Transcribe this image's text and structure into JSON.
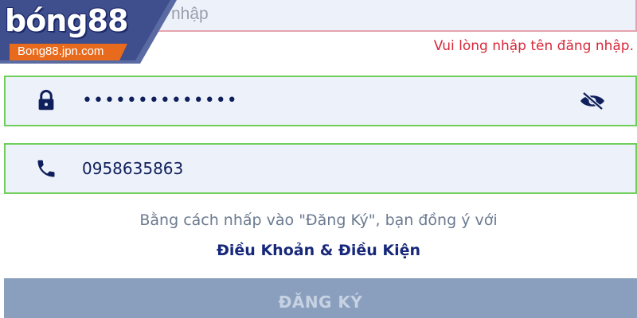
{
  "brand": {
    "logo_text": "bóng88",
    "domain": "Bong88.jpn.com",
    "colors": {
      "navy": "#1d2a6b",
      "badge": "#5a6ba3",
      "orange": "#e86a1c"
    }
  },
  "form": {
    "username": {
      "placeholder": "nhập",
      "value": "",
      "error": "Vui lòng nhập tên đăng nhập.",
      "border_color": "#e6a3ae"
    },
    "password": {
      "icon": "lock-icon",
      "masked_value": "••••••••••••••",
      "toggle_icon": "eye-slash-icon",
      "border_color": "#6fcf5a"
    },
    "phone": {
      "icon": "phone-icon",
      "value": "0958635863",
      "border_color": "#6fcf5a"
    }
  },
  "terms": {
    "notice": "Bằng cách nhấp vào \"Đăng Ký\", bạn đồng ý với",
    "link_label": "Điều Khoản & Điều Kiện"
  },
  "submit": {
    "label": "ĐĂNG KÝ",
    "color": "#8a9fbe"
  }
}
